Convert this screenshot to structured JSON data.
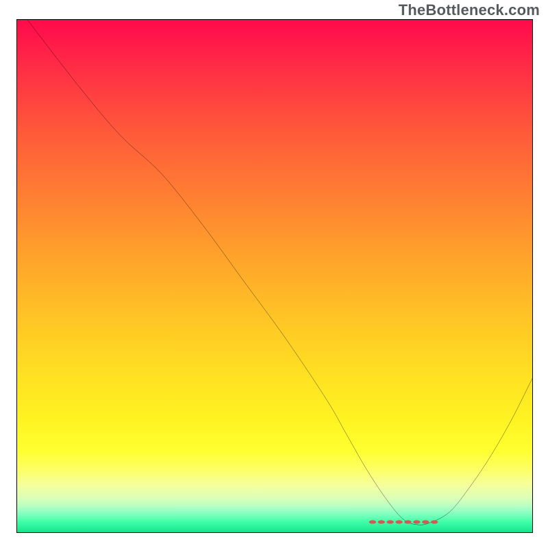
{
  "watermark": "TheBottleneck.com",
  "chart_data": {
    "type": "line",
    "title": "",
    "xlabel": "",
    "ylabel": "",
    "xlim": [
      0,
      100
    ],
    "ylim": [
      0,
      100
    ],
    "grid": false,
    "legend": false,
    "series": [
      {
        "name": "bottleneck-curve",
        "color": "#000000",
        "x": [
          2,
          12,
          20,
          28,
          36,
          44,
          52,
          60,
          64,
          68,
          72,
          75,
          77.5,
          80,
          84,
          88,
          92,
          96,
          100
        ],
        "values": [
          100,
          87,
          77.5,
          70,
          60,
          49,
          38,
          26,
          19,
          12,
          6,
          2.5,
          1.5,
          1.8,
          4,
          9,
          15,
          22,
          30
        ]
      }
    ],
    "annotations": [
      {
        "name": "valley-marker",
        "shape": "dashed-segment",
        "color": "#cf5b55",
        "x_range": [
          69,
          81
        ],
        "y": 2.0
      }
    ],
    "background_gradient": {
      "stops": [
        {
          "pos": 0.0,
          "color": "#ff0a4b"
        },
        {
          "pos": 0.1,
          "color": "#ff2f45"
        },
        {
          "pos": 0.22,
          "color": "#ff5a3a"
        },
        {
          "pos": 0.34,
          "color": "#ff7e32"
        },
        {
          "pos": 0.46,
          "color": "#ffa22b"
        },
        {
          "pos": 0.58,
          "color": "#ffc425"
        },
        {
          "pos": 0.7,
          "color": "#ffe222"
        },
        {
          "pos": 0.78,
          "color": "#fff322"
        },
        {
          "pos": 0.84,
          "color": "#ffff2f"
        },
        {
          "pos": 0.88,
          "color": "#fdff6a"
        },
        {
          "pos": 0.91,
          "color": "#f4ffa0"
        },
        {
          "pos": 0.935,
          "color": "#d8ffb8"
        },
        {
          "pos": 0.95,
          "color": "#b4ffc4"
        },
        {
          "pos": 0.965,
          "color": "#7fffbe"
        },
        {
          "pos": 0.98,
          "color": "#3effa8"
        },
        {
          "pos": 1.0,
          "color": "#16e38e"
        }
      ]
    }
  }
}
